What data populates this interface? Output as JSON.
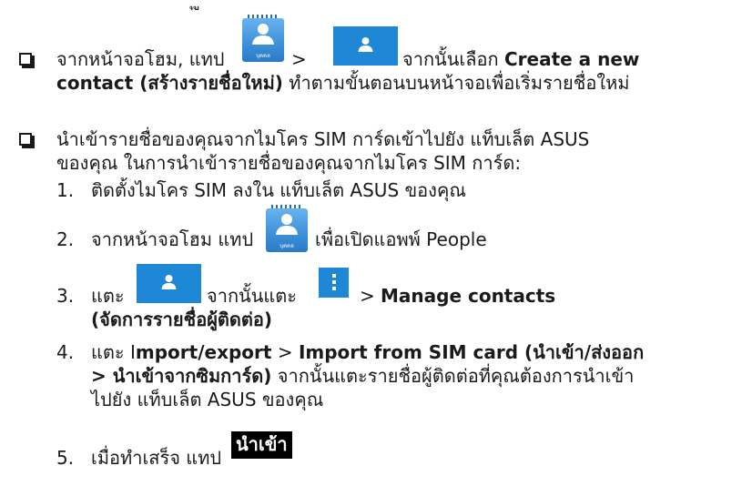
{
  "top_fragment": "ุ ู",
  "bullet1": {
    "line1_pre": "จากหน้าจอโฮม, แทป",
    "gt": ">",
    "line1_post_plain": "จากนั้นเลือก",
    "line1_post_bold": "Create a new",
    "line2_bold": "contact (สร้างรายชื่อใหม่)",
    "line2_plain": "ทำตามขั้นตอนบนหน้าจอเพื่อเริ่มรายชื่อใหม่"
  },
  "people_icon_caption": "บุคคล",
  "bullet2": {
    "line1": "นำเข้ารายชื่อของคุณจากไมโคร SIM การ์ดเข้าไปยัง แท็บเล็ต ASUS",
    "line2": "ของคุณ ในการนำเข้ารายชื่อของคุณจากไมโคร SIM การ์ด:"
  },
  "steps": {
    "s1_num": "1.",
    "s1_text": "ติดตั้งไมโคร SIM ลงใน แท็บเล็ต ASUS ของคุณ",
    "s2_num": "2.",
    "s2_pre": "จากหน้าจอโฮม แทป",
    "s2_post": "เพื่อเปิดแอพพ์ People",
    "s3_num": "3.",
    "s3_pre": "แตะ",
    "s3_mid": "จากนั้นแตะ",
    "s3_gt": ">",
    "s3_bold": "Manage contacts",
    "s3_line2_bold": "(จัดการรายชื่อผู้ติดต่อ)",
    "s4_num": "4.",
    "s4_pre": "แตะ I",
    "s4_bold1": "mport/export",
    "s4_gt": ">",
    "s4_bold2": "Import from SIM card (นำเข้า/ส่งออก",
    "s4_line2_bold": "> นำเข้าจากซิมการ์ด)",
    "s4_line2_plain": "จากนั้นแตะรายชื่อผู้ติดต่อที่คุณต้องการนำเข้า",
    "s4_line3": "ไปยัง แท็บเล็ต ASUS ของคุณ",
    "s5_num": "5.",
    "s5_pre": "เมื่อทำเสร็จ แทป",
    "s5_button": "นำเข้า"
  },
  "colors": {
    "icon_blue": "#1e88d6",
    "text": "#1a1a1a"
  },
  "icons": [
    "people-app-icon",
    "person-icon",
    "overflow-menu-icon"
  ]
}
